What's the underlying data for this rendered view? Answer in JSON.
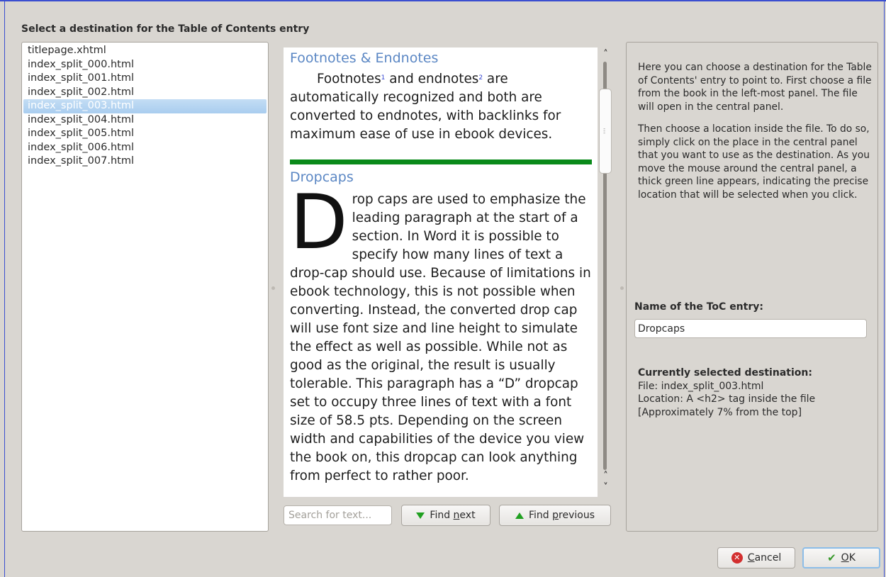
{
  "heading": "Select a destination for the Table of Contents entry",
  "files": [
    {
      "name": "titlepage.xhtml",
      "selected": false
    },
    {
      "name": "index_split_000.html",
      "selected": false
    },
    {
      "name": "index_split_001.html",
      "selected": false
    },
    {
      "name": "index_split_002.html",
      "selected": false
    },
    {
      "name": "index_split_003.html",
      "selected": true
    },
    {
      "name": "index_split_004.html",
      "selected": false
    },
    {
      "name": "index_split_005.html",
      "selected": false
    },
    {
      "name": "index_split_006.html",
      "selected": false
    },
    {
      "name": "index_split_007.html",
      "selected": false
    }
  ],
  "viewer": {
    "h2_footnotes": "Footnotes & Endnotes",
    "footnotes_word": "Footnotes",
    "footnote_sup1": "1",
    "and_endnotes": " and endnotes",
    "footnote_sup2": "2",
    "footnotes_rest": " are automatically recognized and both are converted to endnotes, with backlinks for maximum ease of use in ebook devices.",
    "h2_dropcaps": "Dropcaps",
    "dropcap_letter": "D",
    "dropcaps_text": "rop caps are used to emphasize the leading paragraph at the start of a section. In Word it is possible to specify how many lines of text a drop-cap should use. Because of limitations in ebook technology, this is not possible when converting. Instead, the converted drop cap will use font size and line height to simulate the effect as well as possible. While not as good as the original, the result is usually tolerable. This paragraph has a “D” dropcap set to occupy three lines of text with a font size of 58.5 pts. Depending on the screen width and capabilities of the device you view the book on, this dropcap can look anything from perfect to rather poor."
  },
  "search": {
    "placeholder": "Search for text...",
    "find_next_pre": "Find ",
    "find_next_u": "n",
    "find_next_post": "ext",
    "find_prev_pre": "Find ",
    "find_prev_u": "p",
    "find_prev_post": "revious"
  },
  "help": {
    "para1": "Here you can choose a destination for the Table of Contents' entry to point to. First choose a file from the book in the left-most panel. The file will open in the central panel.",
    "para2": "Then choose a location inside the file. To do so, simply click on the place in the central panel that you want to use as the destination. As you move the mouse around the central panel, a thick green line appears, indicating the precise location that will be selected when you click.",
    "name_label": "Name of the ToC entry:",
    "name_value": "Dropcaps",
    "dest_title": "Currently selected destination:",
    "dest_file": "File: index_split_003.html",
    "dest_location": "Location: A <h2> tag inside the file",
    "dest_approx": "[Approximately 7% from the top]"
  },
  "buttons": {
    "cancel_u": "C",
    "cancel_rest": "ancel",
    "ok_u": "O",
    "ok_rest": "K"
  },
  "colors": {
    "accent_green": "#0a8a1a",
    "heading_blue": "#5b87c4",
    "selection": "#b7d6f1"
  }
}
